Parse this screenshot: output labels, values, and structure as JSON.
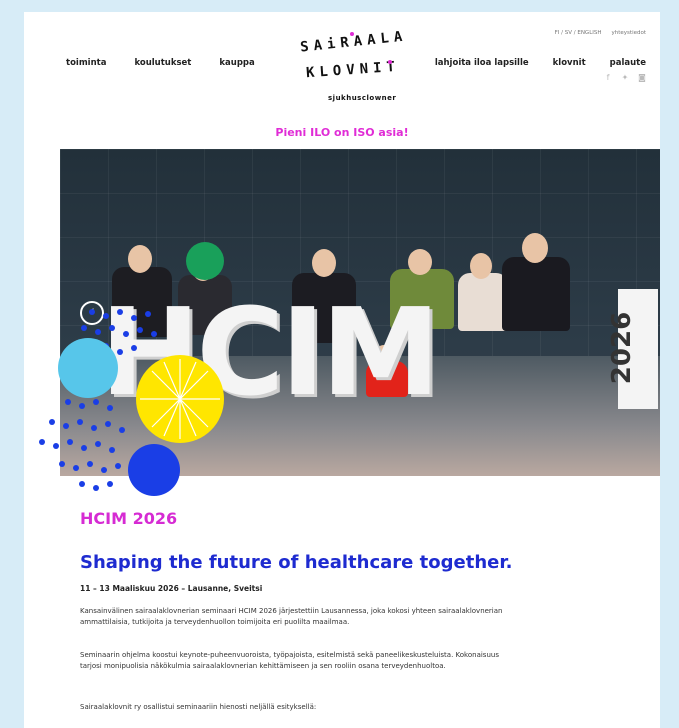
{
  "nav": {
    "left": [
      "toiminta",
      "koulutukset",
      "kauppa"
    ],
    "right": [
      "lahjoita iloa lapsille",
      "klovnit",
      "palaute"
    ]
  },
  "top_links": {
    "languages": "FI / SV / ENGLISH",
    "contact": "yhteystiedot"
  },
  "logo": {
    "line1": "SAiRAALA",
    "line2": "KLOVNIT",
    "subtitle": "sjukhusclowner"
  },
  "tagline": "Pieni ILO on ISO asia!",
  "hero": {
    "banner_text": "HCIM",
    "banner_year": "2026",
    "prev_icon": "chevron-left-icon"
  },
  "event": {
    "heading": "HCIM 2026",
    "title": "Shaping the future of healthcare together.",
    "meta": "11 – 13 Maaliskuu 2026 – Lausanne, Sveitsi",
    "paragraphs": [
      "Kansainvälinen sairaalaklovnerian seminaari HCIM 2026 järjestettiin Lausannessa, joka kokosi yhteen sairaalaklovnerian ammattilaisia, tutkijoita ja terveydenhuollon toimijoita eri puolilta maailmaa.",
      "Seminaarin ohjelma koostui keynote-puheenvuoroista, työpajoista, esitelmistä sekä paneelikeskusteluista. Kokonaisuus tarjosi monipuolisia näkökulmia sairaalaklovnerian kehittämiseen ja sen rooliin osana terveydenhuoltoa.",
      "Sairaalaklovnit ry osallistui seminaariin hienosti neljällä esityksellä:"
    ]
  },
  "colors": {
    "background": "#d7ecf7",
    "magenta": "#e02cd6",
    "blue": "#1e2bd0",
    "yellow": "#ffe600",
    "green": "#19a05a",
    "cyan": "#57c6ea"
  },
  "icons": {
    "facebook": "facebook-icon",
    "twitter": "twitter-icon",
    "instagram": "instagram-icon"
  }
}
